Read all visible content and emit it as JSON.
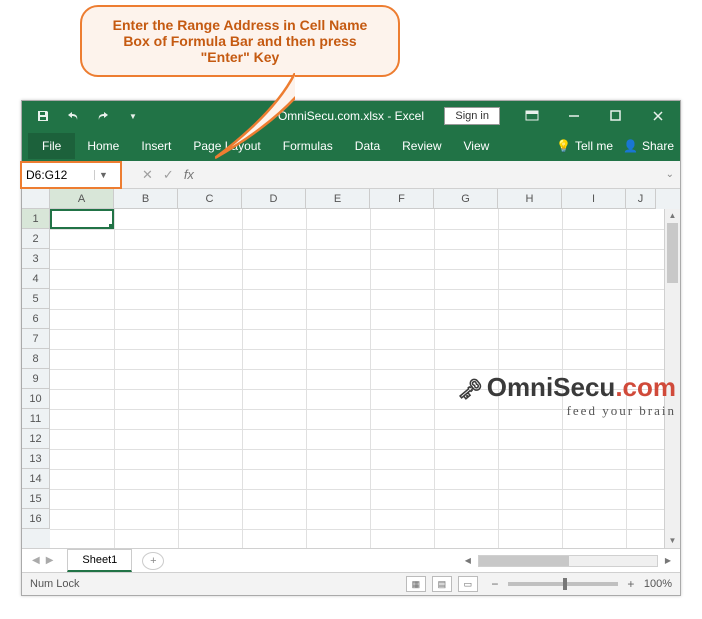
{
  "callout": {
    "text": "Enter the Range Address in Cell Name Box of Formula Bar and then press \"Enter\" Key"
  },
  "titlebar": {
    "title": "OmniSecu.com.xlsx - Excel",
    "signin": "Sign in"
  },
  "ribbon": {
    "tabs": [
      "File",
      "Home",
      "Insert",
      "Page Layout",
      "Formulas",
      "Data",
      "Review",
      "View"
    ],
    "tellme": "Tell me",
    "share": "Share"
  },
  "namebox": {
    "value": "D6:G12"
  },
  "columns": [
    "A",
    "B",
    "C",
    "D",
    "E",
    "F",
    "G",
    "H",
    "I",
    "J"
  ],
  "rows": [
    "1",
    "2",
    "3",
    "4",
    "5",
    "6",
    "7",
    "8",
    "9",
    "10",
    "11",
    "12",
    "13",
    "14",
    "15",
    "16"
  ],
  "sheet": {
    "name": "Sheet1"
  },
  "statusbar": {
    "numlock": "Num Lock",
    "zoom": "100%"
  },
  "watermark": {
    "brand_pre": "mniSecu",
    "brand_dom": ".com",
    "slogan": "feed your brain"
  }
}
